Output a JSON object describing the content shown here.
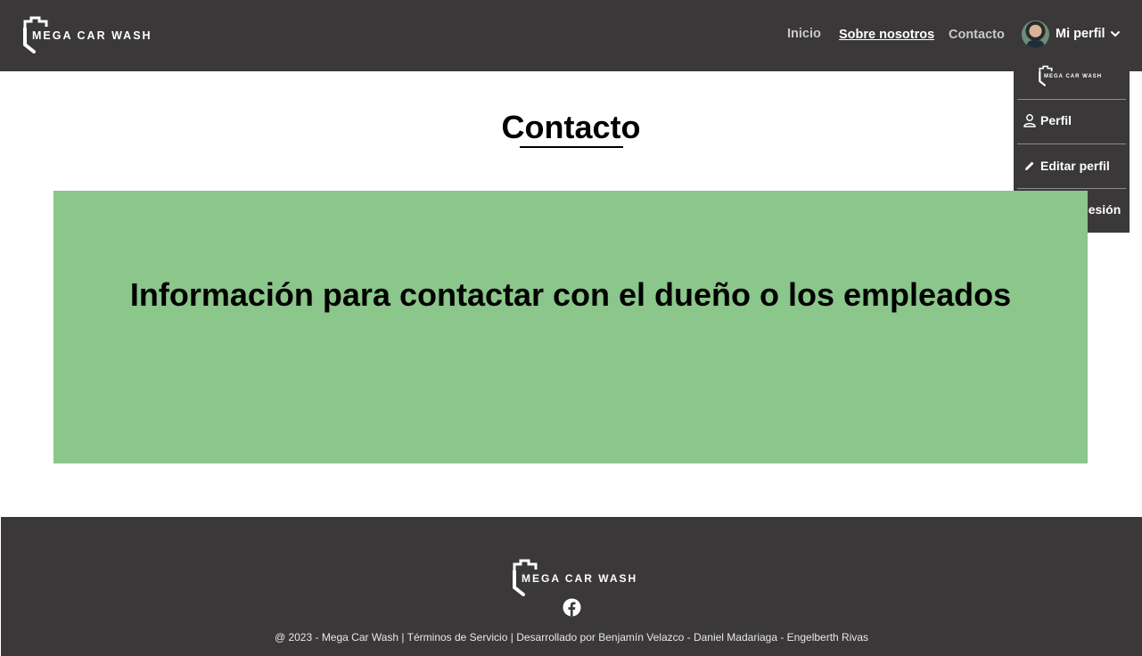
{
  "brand": {
    "name": "MEGA CAR WASH"
  },
  "nav": {
    "inicio": "Inicio",
    "sobre": "Sobre nosotros",
    "contacto": "Contacto",
    "profile": "Mi perfil"
  },
  "dropdown": {
    "items": [
      {
        "label": "Perfil",
        "icon": "person-icon"
      },
      {
        "label": "Editar perfil",
        "icon": "pencil-icon"
      },
      {
        "label": "Cerrar sesión",
        "icon": "logout-icon"
      }
    ]
  },
  "main": {
    "title": "Contacto",
    "heading": "Información para contactar con el dueño o los empleados"
  },
  "footer": {
    "copyright": "@ 2023 - Mega Car Wash",
    "terms": "Términos de Servicio",
    "developed": "Desarrollado por Benjamín Velazco - Daniel Madariaga - Engelberth Rivas",
    "sep": "|"
  },
  "colors": {
    "header_bg": "#3a3839",
    "box_bg": "#8bc68b",
    "text": "#000000"
  }
}
